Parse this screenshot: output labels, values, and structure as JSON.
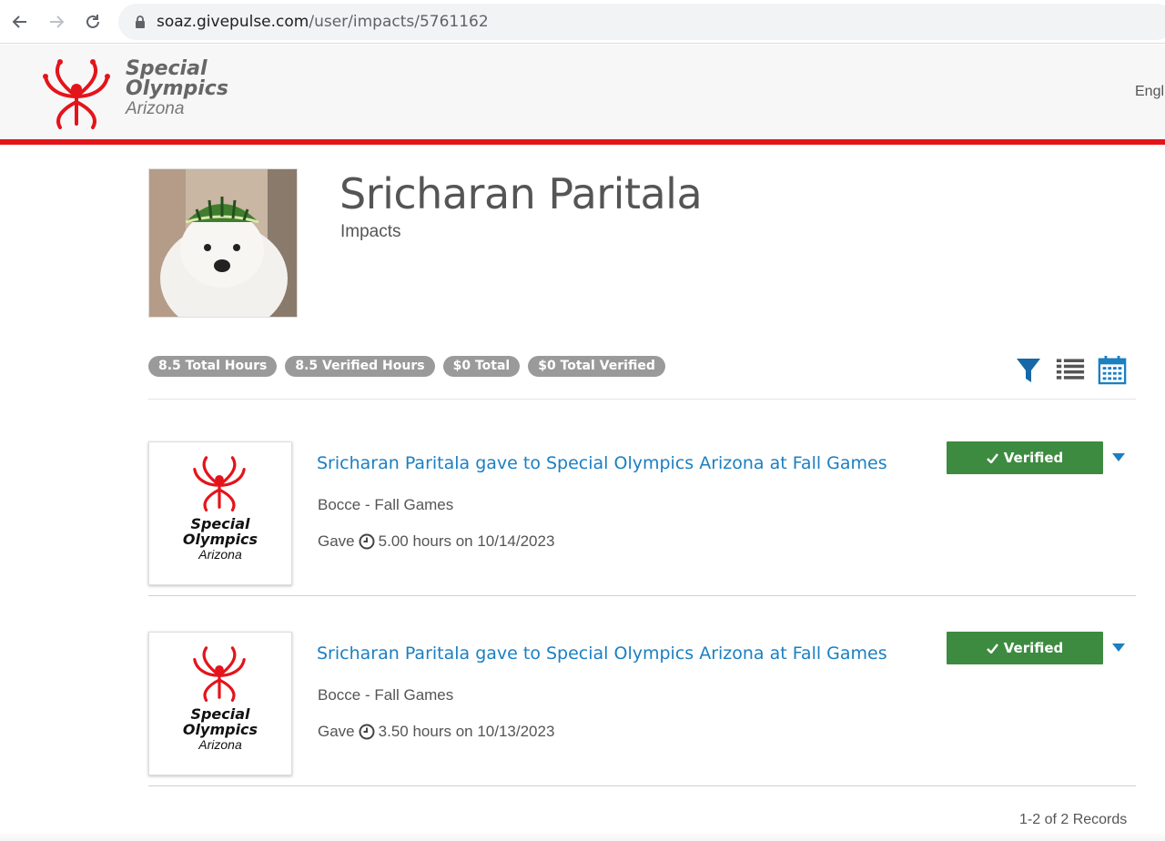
{
  "browser": {
    "url_host": "soaz.givepulse.com",
    "url_path": "/user/impacts/5761162"
  },
  "site": {
    "logo_line1": "Special",
    "logo_line2": "Olympics",
    "logo_line3": "Arizona",
    "language": "English",
    "brand_red": "#e4141b"
  },
  "profile": {
    "name": "Sricharan Paritala",
    "subtitle": "Impacts"
  },
  "badges": [
    "8.5 Total Hours",
    "8.5 Verified Hours",
    "$0 Total",
    "$0 Total Verified"
  ],
  "view_icons": [
    "filter-icon",
    "list-icon",
    "calendar-icon"
  ],
  "impacts": [
    {
      "title": "Sricharan Paritala gave to Special Olympics Arizona at Fall Games",
      "description": "Bocce - Fall Games",
      "action": "Gave",
      "amount": "5.00 hours on 10/14/2023",
      "status": "Verified",
      "logo_line1": "Special",
      "logo_line2": "Olympics",
      "logo_line3": "Arizona"
    },
    {
      "title": "Sricharan Paritala gave to Special Olympics Arizona at Fall Games",
      "description": "Bocce - Fall Games",
      "action": "Gave",
      "amount": "3.50 hours on 10/13/2023",
      "status": "Verified",
      "logo_line1": "Special",
      "logo_line2": "Olympics",
      "logo_line3": "Arizona"
    }
  ],
  "pagination": {
    "records": "1-2 of 2 Records"
  },
  "colors": {
    "link": "#1b7fc2",
    "verified": "#3d8b40",
    "badge": "#9a9a9a"
  }
}
